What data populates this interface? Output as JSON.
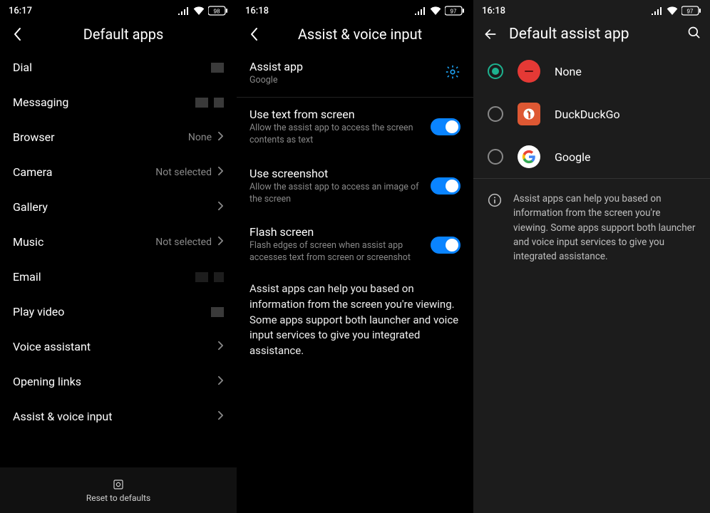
{
  "pane1": {
    "status_time": "16:17",
    "status_battery": "98",
    "title": "Default apps",
    "rows": [
      {
        "label": "Dial",
        "value": "",
        "chevron": false,
        "placeholder": "single"
      },
      {
        "label": "Messaging",
        "value": "",
        "chevron": false,
        "placeholder": "double"
      },
      {
        "label": "Browser",
        "value": "None",
        "chevron": true
      },
      {
        "label": "Camera",
        "value": "Not selected",
        "chevron": true
      },
      {
        "label": "Gallery",
        "value": "",
        "chevron": true
      },
      {
        "label": "Music",
        "value": "Not selected",
        "chevron": true
      },
      {
        "label": "Email",
        "value": "",
        "chevron": false,
        "placeholder": "double-dim"
      },
      {
        "label": "Play video",
        "value": "",
        "chevron": false,
        "placeholder": "single"
      },
      {
        "label": "Voice assistant",
        "value": "",
        "chevron": true
      },
      {
        "label": "Opening links",
        "value": "",
        "chevron": true
      },
      {
        "label": "Assist & voice input",
        "value": "",
        "chevron": true
      }
    ],
    "footer": "Reset to defaults"
  },
  "pane2": {
    "status_time": "16:18",
    "status_battery": "97",
    "title": "Assist & voice input",
    "assist_label": "Assist app",
    "assist_value": "Google",
    "toggles": [
      {
        "title": "Use text from screen",
        "sub": "Allow the assist app to access the screen contents as text",
        "on": true
      },
      {
        "title": "Use screenshot",
        "sub": "Allow the assist app to access an image of the screen",
        "on": true
      },
      {
        "title": "Flash screen",
        "sub": "Flash edges of screen when assist app accesses text from screen or screenshot",
        "on": true
      }
    ],
    "description": "Assist apps can help you based on information from the screen you're viewing. Some apps support both launcher and voice input services to give you integrated assistance."
  },
  "pane3": {
    "status_time": "16:18",
    "status_battery": "97",
    "title": "Default assist app",
    "options": [
      {
        "label": "None",
        "selected": true,
        "icon": "none"
      },
      {
        "label": "DuckDuckGo",
        "selected": false,
        "icon": "ddg"
      },
      {
        "label": "Google",
        "selected": false,
        "icon": "google"
      }
    ],
    "info": "Assist apps can help you based on information from the screen you're viewing. Some apps support both launcher and voice input services to give you integrated assistance."
  }
}
